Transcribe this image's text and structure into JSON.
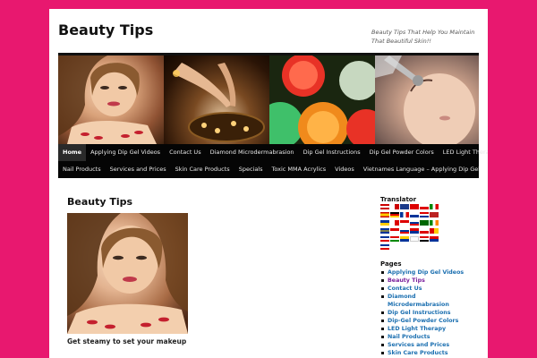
{
  "site": {
    "title": "Beauty Tips",
    "tagline": "Beauty Tips That Help You Maintain That Beautiful Skin!!"
  },
  "colors": {
    "background": "#e8186f",
    "nav_bg": "#050505",
    "link": "#1b6fb0",
    "visited_link": "#7a1f9c"
  },
  "nav": {
    "row1": [
      {
        "label": "Home",
        "active": true
      },
      {
        "label": "Applying Dip Gel Videos"
      },
      {
        "label": "Contact Us"
      },
      {
        "label": "Diamond Microdermabrasion"
      },
      {
        "label": "Dip Gel Instructions"
      },
      {
        "label": "Dip Gel Powder Colors"
      },
      {
        "label": "LED Light Therapy"
      }
    ],
    "row2": [
      {
        "label": "Nail Products"
      },
      {
        "label": "Services and Prices"
      },
      {
        "label": "Skin Care Products"
      },
      {
        "label": "Specials"
      },
      {
        "label": "Toxic MMA Acrylics"
      },
      {
        "label": "Videos"
      },
      {
        "label": "Vietnames Language – Applying Dip Gel"
      }
    ]
  },
  "post": {
    "title": "Beauty Tips",
    "caption": "Get steamy to set your makeup"
  },
  "sidebar": {
    "translator_title": "Translator",
    "pages_title": "Pages",
    "pages": [
      {
        "label": "Applying Dip Gel Videos"
      },
      {
        "label": "Beauty Tips",
        "current": true
      },
      {
        "label": "Contact Us"
      },
      {
        "label": "Diamond Microdermabrasion"
      },
      {
        "label": "Dip Gel Instructions"
      },
      {
        "label": "Dip-Gel Powder Colors"
      },
      {
        "label": "LED Light Therapy"
      },
      {
        "label": "Nail Products"
      },
      {
        "label": "Services and Prices"
      },
      {
        "label": "Skin Care Products"
      }
    ]
  }
}
